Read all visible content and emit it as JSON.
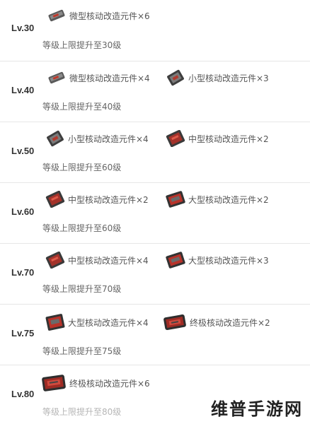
{
  "rows": [
    {
      "level": "Lv.30",
      "items": [
        "微型核动改造元件×6"
      ],
      "cap": "等级上限提升至30级"
    },
    {
      "level": "Lv.40",
      "items": [
        "微型核动改造元件×4",
        "小型核动改造元件×3"
      ],
      "cap": "等级上限提升至40级"
    },
    {
      "level": "Lv.50",
      "items": [
        "小型核动改造元件×4",
        "中型核动改造元件×2"
      ],
      "cap": "等级上限提升至60级"
    },
    {
      "level": "Lv.60",
      "items": [
        "中型核动改造元件×2",
        "大型核动改造元件×2"
      ],
      "cap": "等级上限提升至60级"
    },
    {
      "level": "Lv.70",
      "items": [
        "中型核动改造元件×4",
        "大型核动改造元件×3"
      ],
      "cap": "等级上限提升至70级"
    },
    {
      "level": "Lv.75",
      "items": [
        "大型核动改造元件×4",
        "终极核动改造元件×2"
      ],
      "cap": "等级上限提升至75级"
    },
    {
      "level": "Lv.80",
      "items": [
        "终极核动改造元件×6"
      ],
      "cap": "等级上限提升至80级"
    }
  ],
  "watermark": "维普手游网",
  "icons": {
    "micro": "micro-component-icon",
    "small": "small-component-icon",
    "medium": "medium-component-icon",
    "large": "large-component-icon",
    "ultimate": "ultimate-component-icon"
  },
  "colors": {
    "accent": "#c0392b",
    "metal": "#4a4a4a"
  }
}
